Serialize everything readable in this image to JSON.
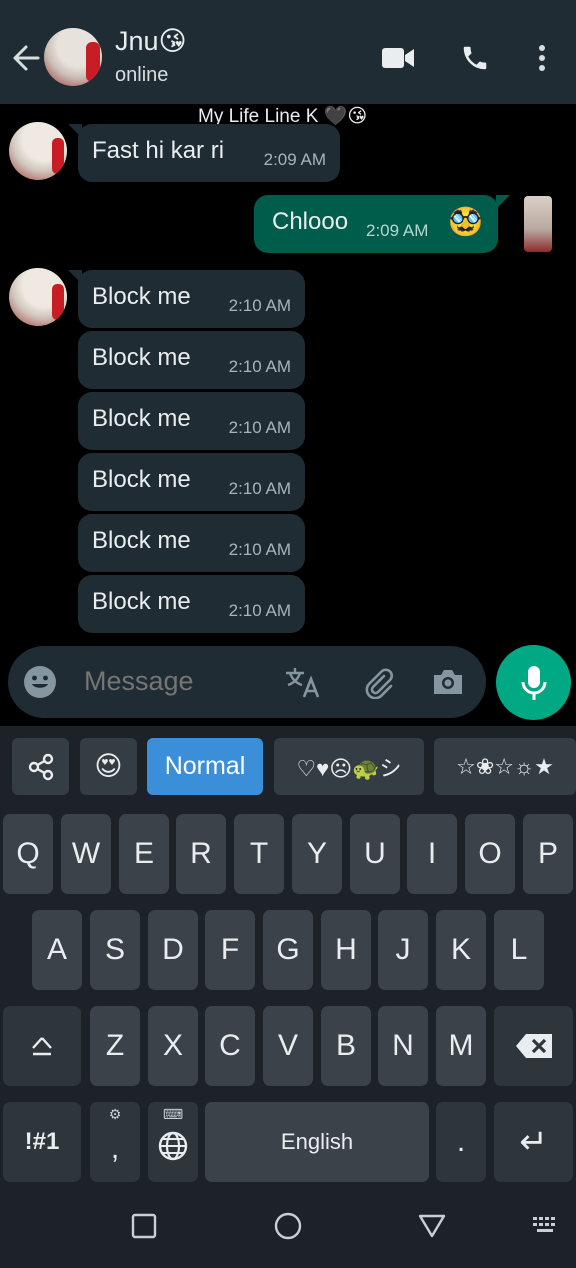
{
  "header": {
    "contact_name": "Jnu😘",
    "status": "online"
  },
  "chat": {
    "group_name": "My Life Line K 🖤😘",
    "messages": [
      {
        "direction": "in",
        "text": "Fast hi kar ri",
        "time": "2:09 AM"
      },
      {
        "direction": "out",
        "text": "Chlooo",
        "time": "2:09 AM",
        "emoji": "🥸"
      },
      {
        "direction": "in",
        "text": "Block me",
        "time": "2:10 AM"
      },
      {
        "direction": "in",
        "text": "Block me",
        "time": "2:10 AM"
      },
      {
        "direction": "in",
        "text": "Block me",
        "time": "2:10 AM"
      },
      {
        "direction": "in",
        "text": "Block me",
        "time": "2:10 AM"
      },
      {
        "direction": "in",
        "text": "Block me",
        "time": "2:10 AM"
      },
      {
        "direction": "in",
        "text": "Block me",
        "time": "2:10 AM"
      }
    ]
  },
  "composer": {
    "placeholder": "Message"
  },
  "keyboard": {
    "toolbar": {
      "emoji": "😍",
      "normal": "Normal",
      "symbols1": "♡♥☹🐢シ",
      "symbols2": "☆❀☆☼★"
    },
    "row1": [
      "Q",
      "W",
      "E",
      "R",
      "T",
      "Y",
      "U",
      "I",
      "O",
      "P"
    ],
    "row2": [
      "A",
      "S",
      "D",
      "F",
      "G",
      "H",
      "J",
      "K",
      "L"
    ],
    "row3": [
      "Z",
      "X",
      "C",
      "V",
      "B",
      "N",
      "M"
    ],
    "symbols_key": "!#1",
    "comma_key": ",",
    "space_label": "English",
    "period_key": ".",
    "enter_key": "↵"
  },
  "colors": {
    "header_bg": "#1f2c34",
    "incoming_bubble": "#202c33",
    "outgoing_bubble": "#005c4b",
    "accent": "#00a884",
    "keyboard_active": "#3a8fd8"
  }
}
